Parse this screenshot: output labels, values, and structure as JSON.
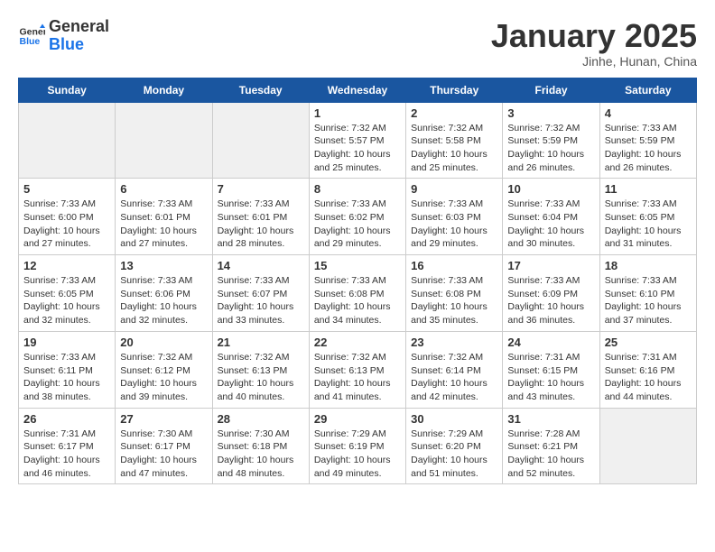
{
  "logo": {
    "line1": "General",
    "line2": "Blue"
  },
  "title": "January 2025",
  "subtitle": "Jinhe, Hunan, China",
  "days_of_week": [
    "Sunday",
    "Monday",
    "Tuesday",
    "Wednesday",
    "Thursday",
    "Friday",
    "Saturday"
  ],
  "weeks": [
    [
      {
        "day": "",
        "info": "",
        "empty": true
      },
      {
        "day": "",
        "info": "",
        "empty": true
      },
      {
        "day": "",
        "info": "",
        "empty": true
      },
      {
        "day": "1",
        "info": "Sunrise: 7:32 AM\nSunset: 5:57 PM\nDaylight: 10 hours and 25 minutes."
      },
      {
        "day": "2",
        "info": "Sunrise: 7:32 AM\nSunset: 5:58 PM\nDaylight: 10 hours and 25 minutes."
      },
      {
        "day": "3",
        "info": "Sunrise: 7:32 AM\nSunset: 5:59 PM\nDaylight: 10 hours and 26 minutes."
      },
      {
        "day": "4",
        "info": "Sunrise: 7:33 AM\nSunset: 5:59 PM\nDaylight: 10 hours and 26 minutes."
      }
    ],
    [
      {
        "day": "5",
        "info": "Sunrise: 7:33 AM\nSunset: 6:00 PM\nDaylight: 10 hours and 27 minutes."
      },
      {
        "day": "6",
        "info": "Sunrise: 7:33 AM\nSunset: 6:01 PM\nDaylight: 10 hours and 27 minutes."
      },
      {
        "day": "7",
        "info": "Sunrise: 7:33 AM\nSunset: 6:01 PM\nDaylight: 10 hours and 28 minutes."
      },
      {
        "day": "8",
        "info": "Sunrise: 7:33 AM\nSunset: 6:02 PM\nDaylight: 10 hours and 29 minutes."
      },
      {
        "day": "9",
        "info": "Sunrise: 7:33 AM\nSunset: 6:03 PM\nDaylight: 10 hours and 29 minutes."
      },
      {
        "day": "10",
        "info": "Sunrise: 7:33 AM\nSunset: 6:04 PM\nDaylight: 10 hours and 30 minutes."
      },
      {
        "day": "11",
        "info": "Sunrise: 7:33 AM\nSunset: 6:05 PM\nDaylight: 10 hours and 31 minutes."
      }
    ],
    [
      {
        "day": "12",
        "info": "Sunrise: 7:33 AM\nSunset: 6:05 PM\nDaylight: 10 hours and 32 minutes."
      },
      {
        "day": "13",
        "info": "Sunrise: 7:33 AM\nSunset: 6:06 PM\nDaylight: 10 hours and 32 minutes."
      },
      {
        "day": "14",
        "info": "Sunrise: 7:33 AM\nSunset: 6:07 PM\nDaylight: 10 hours and 33 minutes."
      },
      {
        "day": "15",
        "info": "Sunrise: 7:33 AM\nSunset: 6:08 PM\nDaylight: 10 hours and 34 minutes."
      },
      {
        "day": "16",
        "info": "Sunrise: 7:33 AM\nSunset: 6:08 PM\nDaylight: 10 hours and 35 minutes."
      },
      {
        "day": "17",
        "info": "Sunrise: 7:33 AM\nSunset: 6:09 PM\nDaylight: 10 hours and 36 minutes."
      },
      {
        "day": "18",
        "info": "Sunrise: 7:33 AM\nSunset: 6:10 PM\nDaylight: 10 hours and 37 minutes."
      }
    ],
    [
      {
        "day": "19",
        "info": "Sunrise: 7:33 AM\nSunset: 6:11 PM\nDaylight: 10 hours and 38 minutes."
      },
      {
        "day": "20",
        "info": "Sunrise: 7:32 AM\nSunset: 6:12 PM\nDaylight: 10 hours and 39 minutes."
      },
      {
        "day": "21",
        "info": "Sunrise: 7:32 AM\nSunset: 6:13 PM\nDaylight: 10 hours and 40 minutes."
      },
      {
        "day": "22",
        "info": "Sunrise: 7:32 AM\nSunset: 6:13 PM\nDaylight: 10 hours and 41 minutes."
      },
      {
        "day": "23",
        "info": "Sunrise: 7:32 AM\nSunset: 6:14 PM\nDaylight: 10 hours and 42 minutes."
      },
      {
        "day": "24",
        "info": "Sunrise: 7:31 AM\nSunset: 6:15 PM\nDaylight: 10 hours and 43 minutes."
      },
      {
        "day": "25",
        "info": "Sunrise: 7:31 AM\nSunset: 6:16 PM\nDaylight: 10 hours and 44 minutes."
      }
    ],
    [
      {
        "day": "26",
        "info": "Sunrise: 7:31 AM\nSunset: 6:17 PM\nDaylight: 10 hours and 46 minutes."
      },
      {
        "day": "27",
        "info": "Sunrise: 7:30 AM\nSunset: 6:17 PM\nDaylight: 10 hours and 47 minutes."
      },
      {
        "day": "28",
        "info": "Sunrise: 7:30 AM\nSunset: 6:18 PM\nDaylight: 10 hours and 48 minutes."
      },
      {
        "day": "29",
        "info": "Sunrise: 7:29 AM\nSunset: 6:19 PM\nDaylight: 10 hours and 49 minutes."
      },
      {
        "day": "30",
        "info": "Sunrise: 7:29 AM\nSunset: 6:20 PM\nDaylight: 10 hours and 51 minutes."
      },
      {
        "day": "31",
        "info": "Sunrise: 7:28 AM\nSunset: 6:21 PM\nDaylight: 10 hours and 52 minutes."
      },
      {
        "day": "",
        "info": "",
        "empty": true
      }
    ]
  ]
}
